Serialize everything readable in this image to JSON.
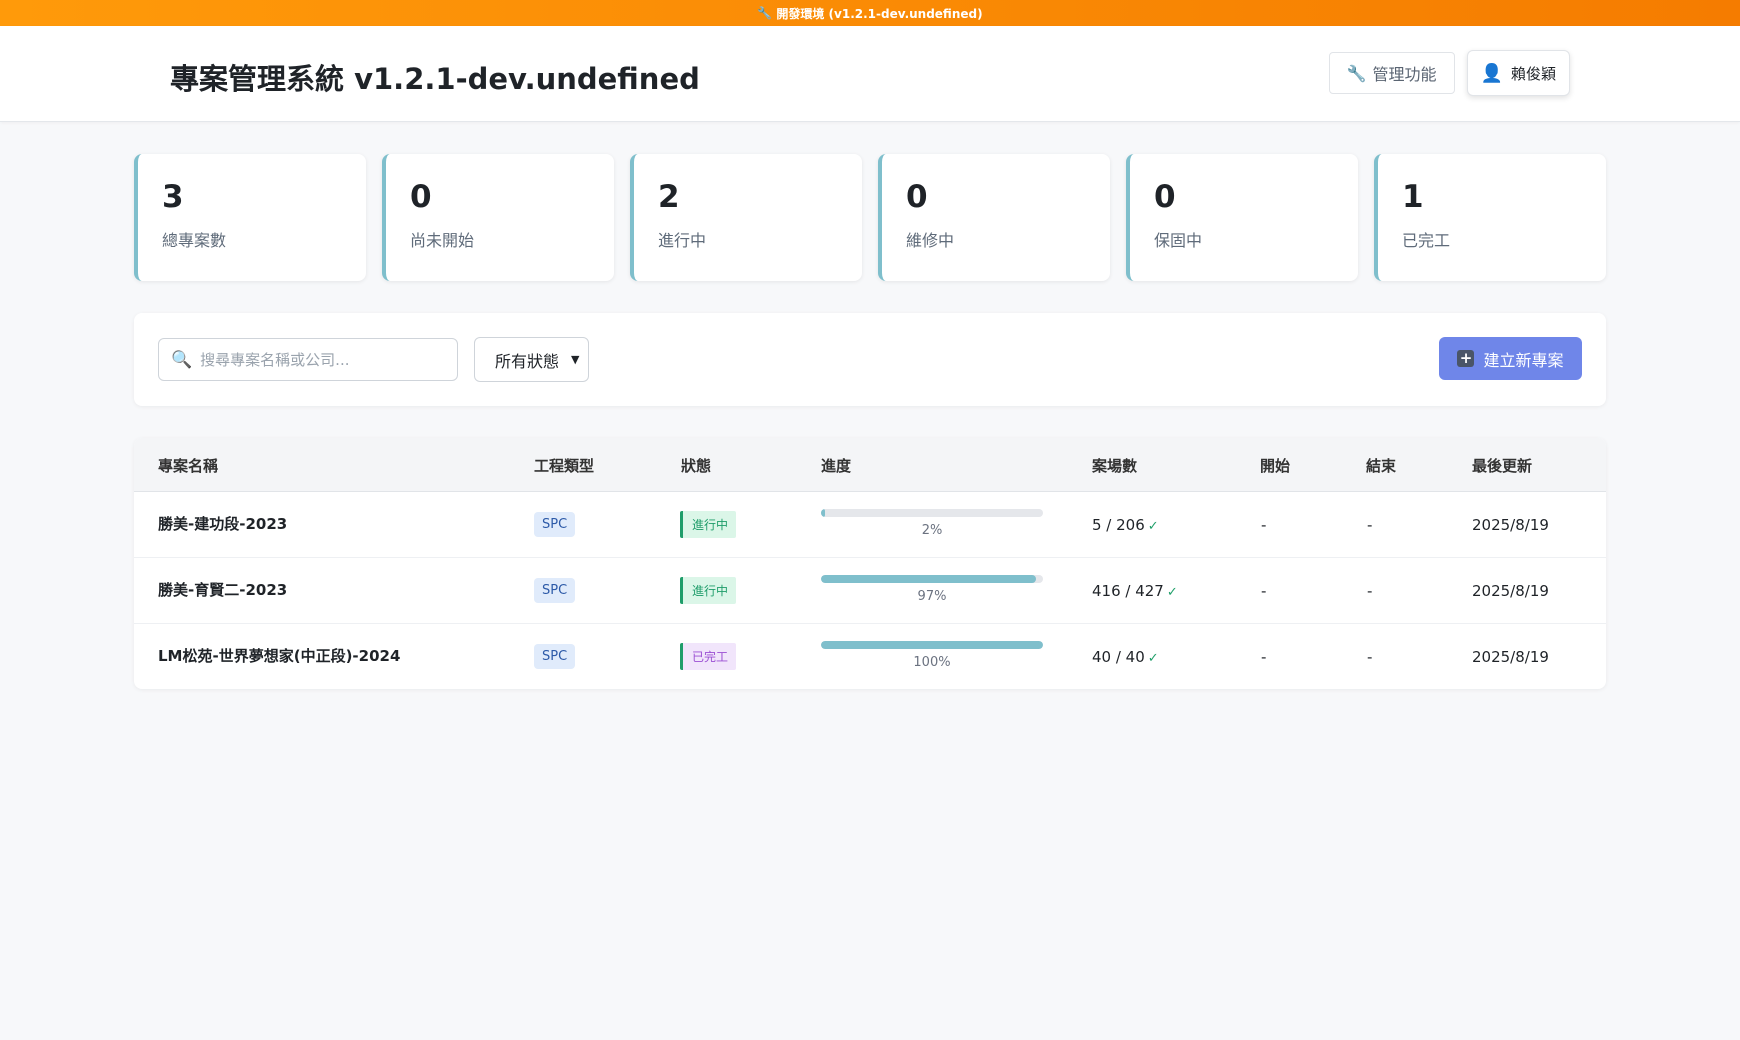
{
  "env_banner": {
    "icon": "wrench-icon",
    "text": "開發環境 (v1.2.1-dev.undefined)"
  },
  "header": {
    "title": "專案管理系統 v1.2.1-dev.undefined",
    "admin_button": "管理功能",
    "user_button": "賴俊穎"
  },
  "stats": [
    {
      "value": "3",
      "label": "總專案數"
    },
    {
      "value": "0",
      "label": "尚未開始"
    },
    {
      "value": "2",
      "label": "進行中"
    },
    {
      "value": "0",
      "label": "維修中"
    },
    {
      "value": "0",
      "label": "保固中"
    },
    {
      "value": "1",
      "label": "已完工"
    }
  ],
  "toolbar": {
    "search_placeholder": "搜尋專案名稱或公司...",
    "status_filter": "所有狀態",
    "create_button": "建立新專案"
  },
  "table": {
    "headers": [
      "專案名稱",
      "工程類型",
      "狀態",
      "進度",
      "案場數",
      "開始",
      "結束",
      "最後更新"
    ],
    "rows": [
      {
        "name": "勝美-建功段-2023",
        "type": "SPC",
        "status": "進行中",
        "progress": 2,
        "progress_label": "2%",
        "sites": "5 / 206",
        "start": "-",
        "end": "-",
        "updated": "2025/8/19"
      },
      {
        "name": "勝美-育賢二-2023",
        "type": "SPC",
        "status": "進行中",
        "progress": 97,
        "progress_label": "97%",
        "sites": "416 / 427",
        "start": "-",
        "end": "-",
        "updated": "2025/8/19"
      },
      {
        "name": "LM松苑-世界夢想家(中正段)-2024",
        "type": "SPC",
        "status": "已完工",
        "progress": 100,
        "progress_label": "100%",
        "sites": "40 / 40",
        "start": "-",
        "end": "-",
        "updated": "2025/8/19"
      }
    ]
  },
  "colors": {
    "banner": "#f57c00",
    "accent": "#6f86e9",
    "progress": "#7fbfcc",
    "stat_border": "#7fbfcc"
  }
}
